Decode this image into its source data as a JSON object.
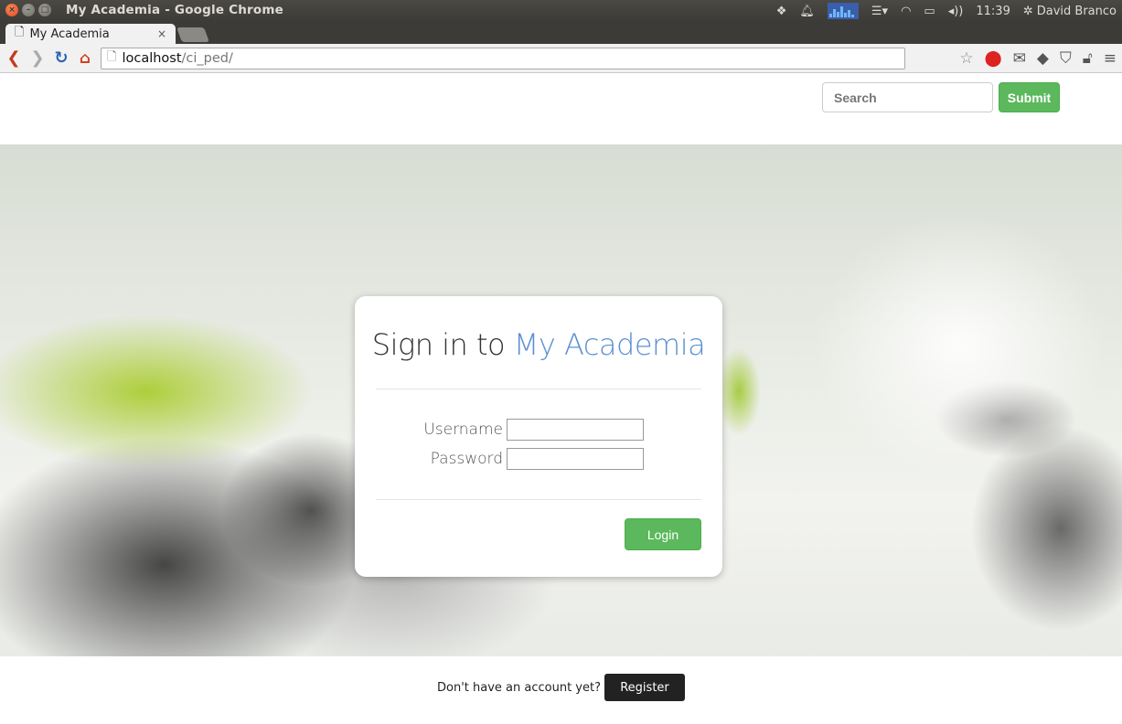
{
  "os_panel": {
    "window_title": "My Academia - Google Chrome",
    "clock": "11:39",
    "user": "David Branco"
  },
  "browser": {
    "tab_title": "My Academia",
    "tab_close": "×",
    "url_host": "localhost",
    "url_path": "/ci_ped/"
  },
  "header": {
    "search_placeholder": "Search",
    "submit_label": "Submit"
  },
  "login": {
    "title_prefix": "Sign in to ",
    "title_brand": "My Academia",
    "username_label": "Username",
    "password_label": "Password",
    "username_value": "",
    "password_value": "",
    "login_label": "Login"
  },
  "footer": {
    "prompt": "Don't have an account yet?",
    "register_label": "Register"
  },
  "colors": {
    "success_green": "#5cb85c",
    "brand_blue": "#5b8fd1",
    "register_dark": "#222222"
  }
}
